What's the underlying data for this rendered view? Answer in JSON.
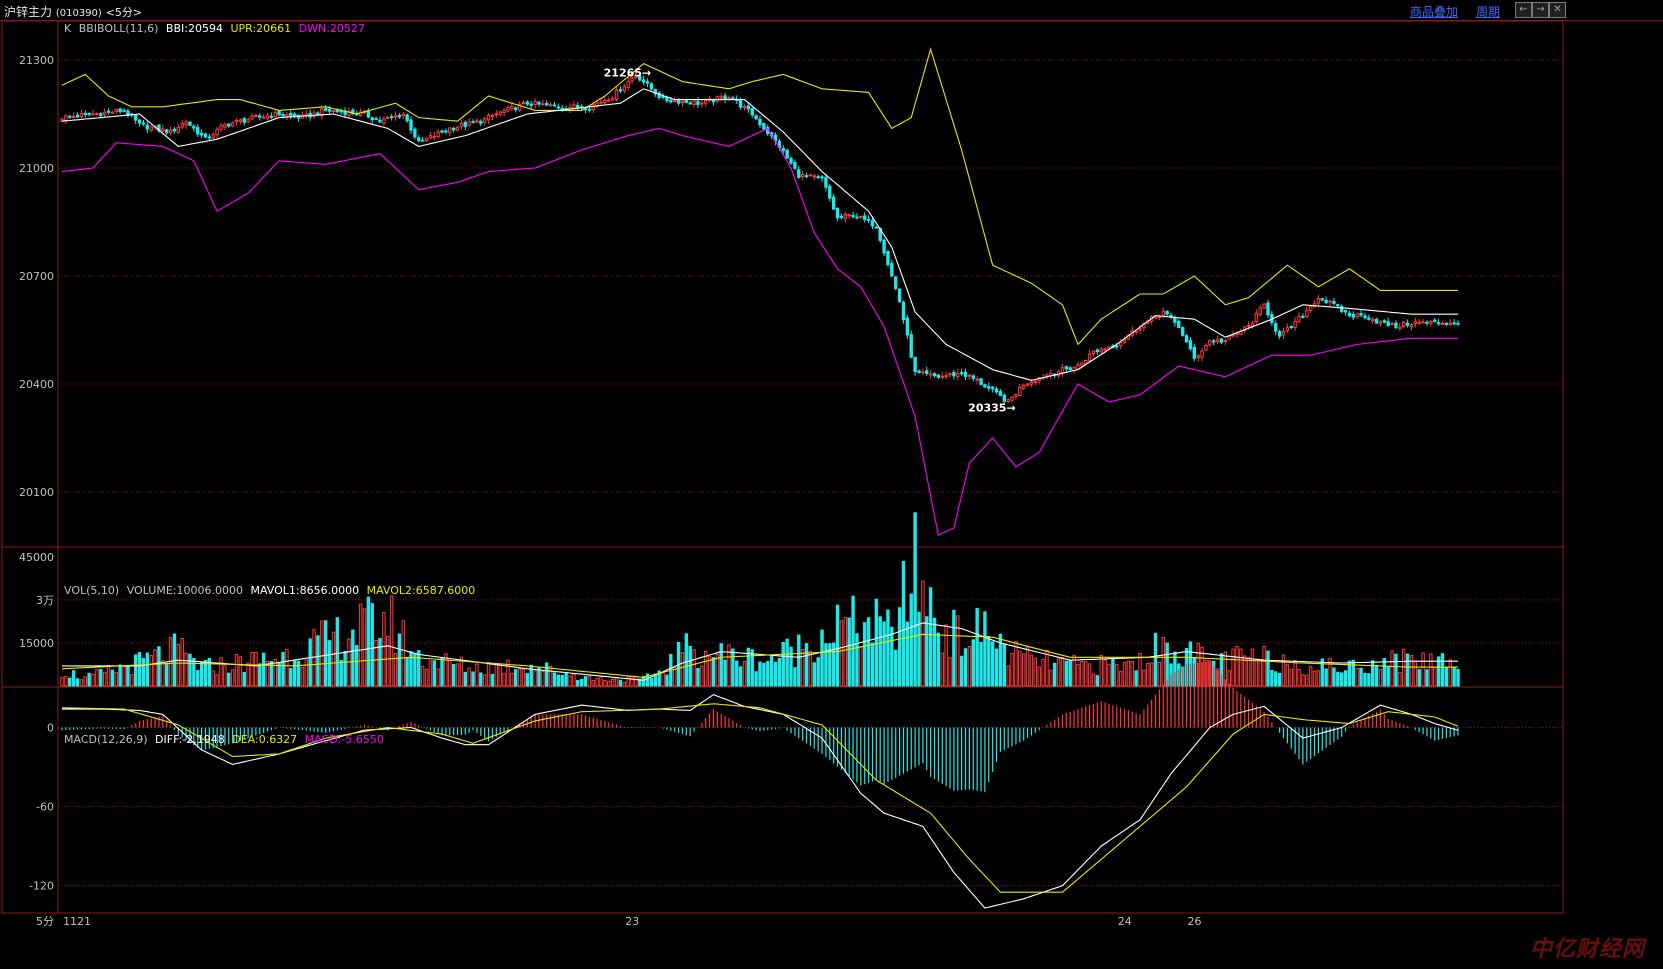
{
  "window": {
    "title": "沪锌主力",
    "code": "(010390)",
    "period": "<5分>",
    "links": [
      "商品叠加",
      "周期"
    ],
    "buttons": [
      "←",
      "→",
      "✕"
    ]
  },
  "headers": {
    "price": {
      "prefix": "K",
      "name": "BBIBOLL(11,6)",
      "bbi": "BBI:20594",
      "upr": "UPR:20661",
      "dwn": "DWN:20527"
    },
    "volume": {
      "name": "VOL(5,10)",
      "volume": "VOLUME:10006.0000",
      "mavol1": "MAVOL1:8656.0000",
      "mavol2": "MAVOL2:6587.6000"
    },
    "macd": {
      "name": "MACD(12,26,9)",
      "diff": "DIFF:-2.1948",
      "dea": "DEA:0.6327",
      "macd": "MACD:-5.6550"
    }
  },
  "colors": {
    "background": "#000000",
    "grid": "#8b1a1a",
    "up": "#ff3a3a",
    "down": "#20e8e8",
    "bbi": "#ffffff",
    "upr": "#e8e800",
    "dwn": "#ff00ff",
    "label": "#c0c0c0"
  },
  "chart_data": [
    {
      "type": "candlestick",
      "title": "BBIBOLL(11,6)",
      "ylim": [
        19950,
        21400
      ],
      "yticks": [
        21300,
        21000,
        20700,
        20400,
        20100
      ],
      "x_labels": [
        "1121",
        "23",
        "24",
        "26"
      ],
      "period_label": "5分",
      "annotations": [
        {
          "label": "21265",
          "value": 21265
        },
        {
          "label": "20335",
          "value": 20335
        }
      ],
      "close_anchors": [
        [
          0,
          21140
        ],
        [
          8,
          21150
        ],
        [
          16,
          21160
        ],
        [
          20,
          21120
        ],
        [
          28,
          21100
        ],
        [
          32,
          21130
        ],
        [
          37,
          21080
        ],
        [
          42,
          21120
        ],
        [
          50,
          21140
        ],
        [
          56,
          21150
        ],
        [
          62,
          21140
        ],
        [
          68,
          21160
        ],
        [
          78,
          21150
        ],
        [
          82,
          21130
        ],
        [
          88,
          21150
        ],
        [
          92,
          21070
        ],
        [
          100,
          21110
        ],
        [
          108,
          21130
        ],
        [
          112,
          21150
        ],
        [
          120,
          21180
        ],
        [
          128,
          21170
        ],
        [
          136,
          21170
        ],
        [
          142,
          21200
        ],
        [
          148,
          21260
        ],
        [
          155,
          21190
        ],
        [
          165,
          21180
        ],
        [
          172,
          21200
        ],
        [
          178,
          21150
        ],
        [
          185,
          21060
        ],
        [
          190,
          20980
        ],
        [
          196,
          20970
        ],
        [
          200,
          20860
        ],
        [
          204,
          20870
        ],
        [
          210,
          20840
        ],
        [
          216,
          20630
        ],
        [
          220,
          20430
        ],
        [
          226,
          20420
        ],
        [
          232,
          20430
        ],
        [
          236,
          20410
        ],
        [
          240,
          20380
        ],
        [
          244,
          20350
        ],
        [
          248,
          20400
        ],
        [
          255,
          20430
        ],
        [
          262,
          20450
        ],
        [
          266,
          20490
        ],
        [
          272,
          20510
        ],
        [
          278,
          20560
        ],
        [
          284,
          20600
        ],
        [
          288,
          20560
        ],
        [
          292,
          20470
        ],
        [
          296,
          20520
        ],
        [
          300,
          20520
        ],
        [
          306,
          20560
        ],
        [
          310,
          20620
        ],
        [
          314,
          20530
        ],
        [
          318,
          20570
        ],
        [
          324,
          20640
        ],
        [
          328,
          20620
        ],
        [
          332,
          20590
        ],
        [
          336,
          20590
        ],
        [
          340,
          20570
        ],
        [
          344,
          20560
        ],
        [
          348,
          20570
        ]
      ],
      "bbi_anchors": [
        [
          0,
          21130
        ],
        [
          20,
          21150
        ],
        [
          30,
          21060
        ],
        [
          40,
          21080
        ],
        [
          56,
          21140
        ],
        [
          70,
          21150
        ],
        [
          84,
          21110
        ],
        [
          92,
          21060
        ],
        [
          104,
          21090
        ],
        [
          120,
          21150
        ],
        [
          136,
          21170
        ],
        [
          144,
          21180
        ],
        [
          150,
          21220
        ],
        [
          158,
          21190
        ],
        [
          176,
          21190
        ],
        [
          186,
          21100
        ],
        [
          196,
          20990
        ],
        [
          208,
          20880
        ],
        [
          214,
          20780
        ],
        [
          220,
          20600
        ],
        [
          228,
          20510
        ],
        [
          240,
          20440
        ],
        [
          250,
          20410
        ],
        [
          262,
          20440
        ],
        [
          272,
          20510
        ],
        [
          282,
          20590
        ],
        [
          292,
          20580
        ],
        [
          300,
          20530
        ],
        [
          312,
          20580
        ],
        [
          320,
          20620
        ],
        [
          332,
          20610
        ],
        [
          348,
          20594
        ]
      ],
      "upr_anchors": [
        [
          0,
          21230
        ],
        [
          6,
          21260
        ],
        [
          12,
          21200
        ],
        [
          18,
          21170
        ],
        [
          26,
          21170
        ],
        [
          40,
          21190
        ],
        [
          46,
          21190
        ],
        [
          56,
          21160
        ],
        [
          68,
          21170
        ],
        [
          76,
          21150
        ],
        [
          86,
          21180
        ],
        [
          92,
          21140
        ],
        [
          102,
          21130
        ],
        [
          110,
          21200
        ],
        [
          122,
          21160
        ],
        [
          134,
          21160
        ],
        [
          140,
          21200
        ],
        [
          150,
          21290
        ],
        [
          160,
          21240
        ],
        [
          172,
          21220
        ],
        [
          178,
          21240
        ],
        [
          186,
          21260
        ],
        [
          196,
          21220
        ],
        [
          208,
          21210
        ],
        [
          214,
          21110
        ],
        [
          219,
          21140
        ],
        [
          224,
          21330
        ],
        [
          232,
          21050
        ],
        [
          240,
          20730
        ],
        [
          250,
          20680
        ],
        [
          258,
          20620
        ],
        [
          262,
          20510
        ],
        [
          268,
          20580
        ],
        [
          278,
          20650
        ],
        [
          284,
          20650
        ],
        [
          292,
          20700
        ],
        [
          300,
          20620
        ],
        [
          306,
          20640
        ],
        [
          316,
          20730
        ],
        [
          324,
          20670
        ],
        [
          332,
          20720
        ],
        [
          340,
          20660
        ],
        [
          348,
          20660
        ]
      ],
      "dwn_anchors": [
        [
          0,
          20990
        ],
        [
          8,
          21000
        ],
        [
          14,
          21070
        ],
        [
          26,
          21060
        ],
        [
          34,
          21020
        ],
        [
          40,
          20880
        ],
        [
          48,
          20930
        ],
        [
          56,
          21020
        ],
        [
          68,
          21010
        ],
        [
          82,
          21040
        ],
        [
          92,
          20940
        ],
        [
          102,
          20960
        ],
        [
          110,
          20990
        ],
        [
          122,
          21000
        ],
        [
          134,
          21050
        ],
        [
          146,
          21090
        ],
        [
          154,
          21110
        ],
        [
          160,
          21090
        ],
        [
          172,
          21060
        ],
        [
          182,
          21110
        ],
        [
          188,
          21000
        ],
        [
          194,
          20820
        ],
        [
          200,
          20720
        ],
        [
          206,
          20670
        ],
        [
          212,
          20560
        ],
        [
          220,
          20310
        ],
        [
          226,
          19980
        ],
        [
          230,
          20000
        ],
        [
          234,
          20180
        ],
        [
          240,
          20250
        ],
        [
          246,
          20170
        ],
        [
          252,
          20210
        ],
        [
          262,
          20400
        ],
        [
          270,
          20350
        ],
        [
          278,
          20370
        ],
        [
          288,
          20450
        ],
        [
          300,
          20420
        ],
        [
          312,
          20480
        ],
        [
          322,
          20480
        ],
        [
          334,
          20510
        ],
        [
          348,
          20527
        ]
      ]
    },
    {
      "type": "bar",
      "title": "VOL(5,10)",
      "ylim": [
        0,
        46000
      ],
      "yticks": [
        45000,
        30000,
        15000
      ],
      "ytick_labels": [
        "45000",
        "3万",
        "15000"
      ],
      "bar_anchors": [
        [
          0,
          6000
        ],
        [
          6,
          3000
        ],
        [
          20,
          9000
        ],
        [
          30,
          14000
        ],
        [
          36,
          7000
        ],
        [
          56,
          11000
        ],
        [
          84,
          26000
        ],
        [
          92,
          11000
        ],
        [
          106,
          7000
        ],
        [
          120,
          8000
        ],
        [
          136,
          3000
        ],
        [
          150,
          2500
        ],
        [
          155,
          6000
        ],
        [
          160,
          14000
        ],
        [
          166,
          13000
        ],
        [
          182,
          10000
        ],
        [
          192,
          16000
        ],
        [
          200,
          23000
        ],
        [
          208,
          24000
        ],
        [
          214,
          20000
        ],
        [
          220,
          45000
        ],
        [
          226,
          24000
        ],
        [
          232,
          18000
        ],
        [
          238,
          22000
        ],
        [
          244,
          13000
        ],
        [
          250,
          10000
        ],
        [
          260,
          8000
        ],
        [
          270,
          8000
        ],
        [
          276,
          8000
        ],
        [
          282,
          14000
        ],
        [
          288,
          15000
        ],
        [
          296,
          9000
        ],
        [
          306,
          11000
        ],
        [
          312,
          10000
        ],
        [
          322,
          8000
        ],
        [
          332,
          7000
        ],
        [
          340,
          10000
        ],
        [
          348,
          10006
        ]
      ],
      "mavol1_anchors": [
        [
          0,
          7000
        ],
        [
          20,
          7000
        ],
        [
          30,
          9000
        ],
        [
          50,
          7000
        ],
        [
          84,
          14000
        ],
        [
          92,
          11000
        ],
        [
          120,
          6000
        ],
        [
          150,
          2000
        ],
        [
          160,
          8000
        ],
        [
          170,
          12000
        ],
        [
          190,
          10000
        ],
        [
          200,
          13000
        ],
        [
          214,
          18000
        ],
        [
          222,
          22000
        ],
        [
          232,
          20000
        ],
        [
          242,
          15000
        ],
        [
          260,
          9000
        ],
        [
          280,
          10000
        ],
        [
          290,
          12000
        ],
        [
          310,
          9000
        ],
        [
          330,
          8000
        ],
        [
          348,
          8656
        ]
      ],
      "mavol2_anchors": [
        [
          0,
          6000
        ],
        [
          30,
          8000
        ],
        [
          60,
          7000
        ],
        [
          90,
          10000
        ],
        [
          120,
          7000
        ],
        [
          150,
          3000
        ],
        [
          170,
          10000
        ],
        [
          200,
          12000
        ],
        [
          222,
          18000
        ],
        [
          240,
          17000
        ],
        [
          260,
          10000
        ],
        [
          290,
          10000
        ],
        [
          320,
          8000
        ],
        [
          348,
          6588
        ]
      ]
    },
    {
      "type": "bar",
      "title": "MACD(12,26,9)",
      "ylim": [
        -140,
        30
      ],
      "yticks": [
        0,
        -60,
        -120
      ],
      "diff_anchors": [
        [
          0,
          14
        ],
        [
          10,
          14
        ],
        [
          20,
          13
        ],
        [
          26,
          10
        ],
        [
          36,
          -17
        ],
        [
          44,
          -28
        ],
        [
          56,
          -20
        ],
        [
          68,
          -10
        ],
        [
          78,
          -2
        ],
        [
          90,
          0
        ],
        [
          98,
          -8
        ],
        [
          104,
          -13
        ],
        [
          110,
          -13
        ],
        [
          122,
          10
        ],
        [
          134,
          17
        ],
        [
          146,
          13
        ],
        [
          154,
          14
        ],
        [
          162,
          13
        ],
        [
          168,
          25
        ],
        [
          176,
          16
        ],
        [
          186,
          10
        ],
        [
          196,
          -8
        ],
        [
          206,
          -50
        ],
        [
          212,
          -65
        ],
        [
          222,
          -75
        ],
        [
          230,
          -110
        ],
        [
          238,
          -137
        ],
        [
          248,
          -130
        ],
        [
          258,
          -120
        ],
        [
          268,
          -90
        ],
        [
          278,
          -70
        ],
        [
          286,
          -35
        ],
        [
          296,
          0
        ],
        [
          302,
          10
        ],
        [
          310,
          16
        ],
        [
          320,
          -8
        ],
        [
          330,
          0
        ],
        [
          340,
          17
        ],
        [
          348,
          10
        ],
        [
          354,
          3
        ],
        [
          360,
          -2
        ]
      ],
      "dea_anchors": [
        [
          0,
          15
        ],
        [
          16,
          14
        ],
        [
          30,
          2
        ],
        [
          44,
          -22
        ],
        [
          56,
          -20
        ],
        [
          68,
          -8
        ],
        [
          84,
          0
        ],
        [
          98,
          -5
        ],
        [
          106,
          -12
        ],
        [
          122,
          5
        ],
        [
          134,
          12
        ],
        [
          154,
          14
        ],
        [
          168,
          18
        ],
        [
          180,
          15
        ],
        [
          196,
          2
        ],
        [
          210,
          -40
        ],
        [
          224,
          -65
        ],
        [
          234,
          -100
        ],
        [
          242,
          -125
        ],
        [
          258,
          -125
        ],
        [
          268,
          -100
        ],
        [
          280,
          -70
        ],
        [
          290,
          -45
        ],
        [
          302,
          -5
        ],
        [
          310,
          10
        ],
        [
          320,
          6
        ],
        [
          332,
          3
        ],
        [
          342,
          12
        ],
        [
          354,
          8
        ],
        [
          360,
          1
        ]
      ]
    }
  ]
}
